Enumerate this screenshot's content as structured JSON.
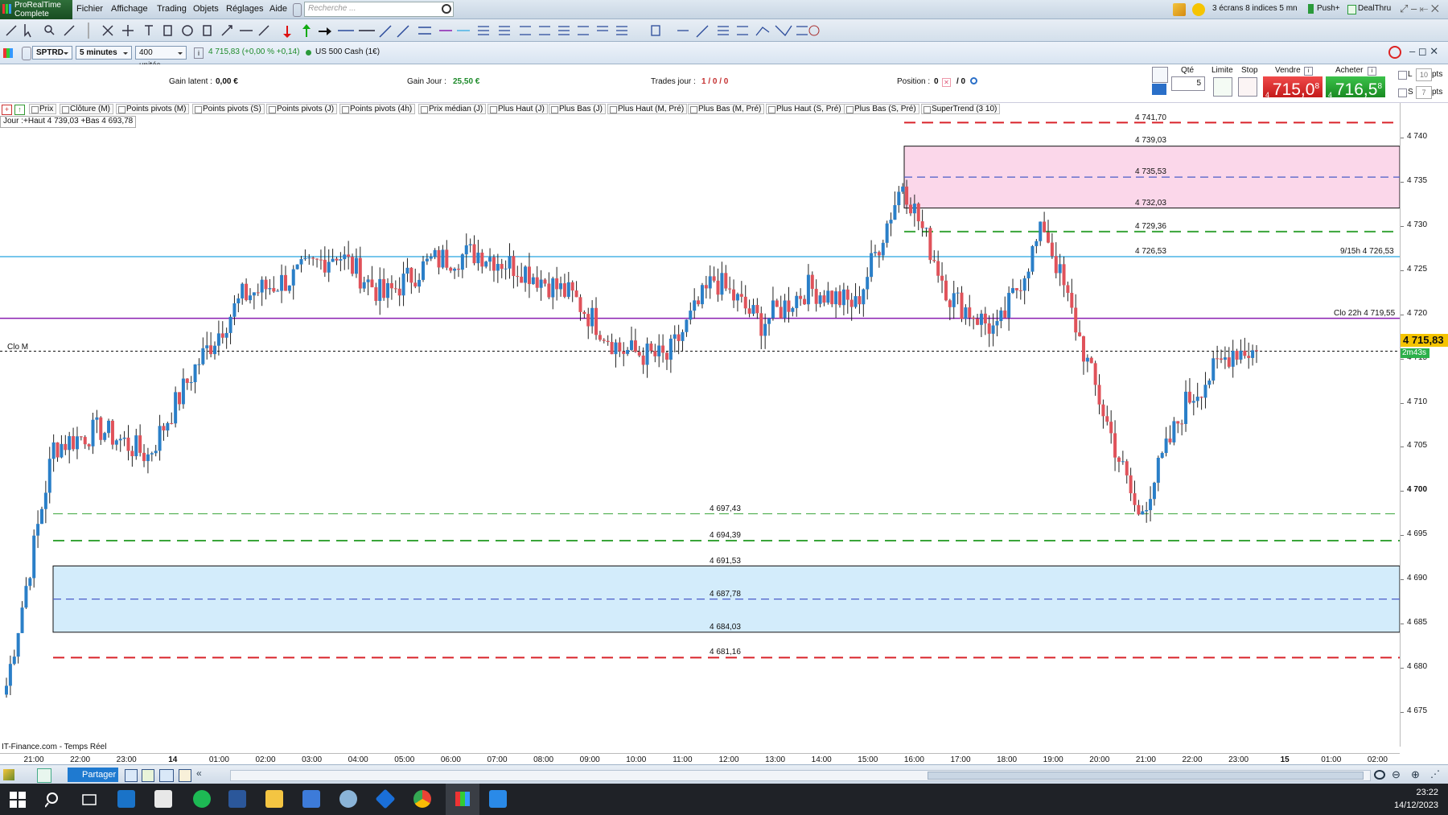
{
  "app": {
    "brand": "ProRealTime",
    "edition": "Complete"
  },
  "menu": [
    "Fichier",
    "Affichage",
    "Trading",
    "Objets",
    "Réglages",
    "Aide"
  ],
  "search": {
    "placeholder": "Recherche ..."
  },
  "topright": {
    "layout": "3 écrans 8 indices 5 mn",
    "push": "Push+",
    "dealthru": "DealThru"
  },
  "instrument": {
    "symbol": "SPTRD",
    "timeframe": "5 minutes",
    "units": "400 unités",
    "quote": "4 715,83 (+0,00 % +0,14)",
    "name": "US 500 Cash (1€)"
  },
  "info": {
    "gain_latent_label": "Gain latent :",
    "gain_latent": "0,00 €",
    "gain_jour_label": "Gain Jour :",
    "gain_jour": "25,50 €",
    "trades_label": "Trades jour :",
    "trades": "1 / 0 / 0",
    "position_label": "Position :",
    "position": "0",
    "position_sep": "/ 0"
  },
  "order": {
    "qty_label": "Qté",
    "qty": "5",
    "limit_label": "Limite",
    "stop_label": "Stop",
    "sell_label": "Vendre",
    "buy_label": "Acheter",
    "sell_price": "715,0",
    "sell_sup": "8",
    "sell_small": "4",
    "buy_price": "716,5",
    "buy_sup": "8",
    "buy_small": "4",
    "l_label": "L",
    "s_label": "S",
    "l_pts": "10",
    "s_pts": "7",
    "pts": "pts"
  },
  "indicators": [
    "Prix",
    "Clôture (M)",
    "Points pivots (M)",
    "Points pivots (S)",
    "Points pivots (J)",
    "Points pivots (4h)",
    "Prix médian (J)",
    "Plus Haut (J)",
    "Plus Bas (J)",
    "Plus Haut (M, Pré)",
    "Plus Bas (M, Pré)",
    "Plus Haut (S, Pré)",
    "Plus Bas (S, Pré)",
    "SuperTrend (3 10)"
  ],
  "range_label": "Jour :+Haut 4 739,03 +Bas 4 693,78",
  "levels_upper": [
    "4 741,70",
    "4 739,03",
    "4 735,53",
    "4 732,03",
    "4 729,36",
    "4 726,53"
  ],
  "levels_lower": [
    "4 697,43",
    "4 694,39",
    "4 691,53",
    "4 687,78",
    "4 684,03",
    "4 681,16"
  ],
  "line_labels": {
    "blue": "9/15h 4 726,53",
    "purple": "Clo 22h 4 719,55",
    "clo_m": "Clo M"
  },
  "last_price": {
    "value": "4 715,83",
    "timer": "2m43s"
  },
  "source": "IT-Finance.com - Temps Réel",
  "y_ticks": [
    "4 740",
    "4 735",
    "4 730",
    "4 725",
    "4 720",
    "4 715",
    "4 710",
    "4 705",
    "4 700",
    "4 695",
    "4 690",
    "4 685",
    "4 680",
    "4 675"
  ],
  "x_ticks": [
    "21:00",
    "22:00",
    "23:00",
    "14",
    "01:00",
    "02:00",
    "03:00",
    "04:00",
    "05:00",
    "06:00",
    "07:00",
    "08:00",
    "09:00",
    "10:00",
    "11:00",
    "12:00",
    "13:00",
    "14:00",
    "15:00",
    "16:00",
    "17:00",
    "18:00",
    "19:00",
    "20:00",
    "21:00",
    "22:00",
    "23:00",
    "15",
    "01:00",
    "02:00"
  ],
  "bottom": {
    "share": "Partager"
  },
  "clock": {
    "time": "23:22",
    "date": "14/12/2023"
  },
  "colors": {
    "up": "#2a7fc8",
    "down": "#e0525a",
    "pink_zone": "#fbd7ea",
    "blue_zone": "#d3ecfb",
    "pivot_red": "#d9232a",
    "pivot_green": "#3aa53a",
    "line_blue": "#4ab3e6",
    "line_purple": "#8a1fb0"
  },
  "chart_data": {
    "type": "candlestick",
    "ylim": [
      4672,
      4744
    ],
    "x": [
      "20:40",
      "21:40",
      "22:40",
      "23:40",
      "00:40",
      "01:40",
      "02:40",
      "03:40",
      "04:40",
      "05:40",
      "06:40",
      "07:40",
      "08:40",
      "09:40",
      "10:40",
      "11:40",
      "12:40",
      "13:40",
      "14:40",
      "15:40",
      "16:40",
      "17:40",
      "18:40",
      "19:40",
      "20:40",
      "21:40",
      "22:40",
      "23:10"
    ],
    "close": [
      4678,
      4705,
      4707,
      4704,
      4714,
      4722,
      4724,
      4727,
      4722,
      4726,
      4727,
      4725,
      4722,
      4716,
      4715,
      4724,
      4719,
      4723,
      4721,
      4735,
      4722,
      4718,
      4730,
      4713,
      4697,
      4710,
      4716,
      4715.83
    ]
  }
}
